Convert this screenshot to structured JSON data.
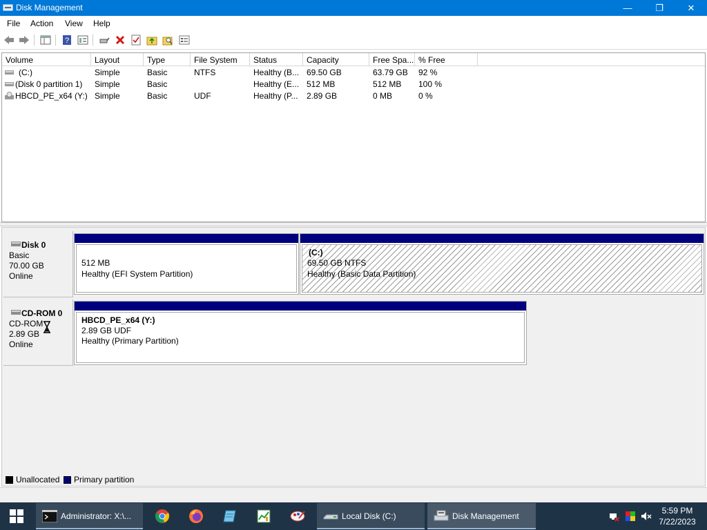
{
  "window": {
    "title": "Disk Management",
    "min_glyph": "—",
    "max_glyph": "❐",
    "close_glyph": "✕"
  },
  "menu": [
    "File",
    "Action",
    "View",
    "Help"
  ],
  "toolbar_icons": [
    "back-arrow-icon",
    "forward-arrow-icon",
    "console-tree-icon",
    "help-icon",
    "properties-icon",
    "connect-disk-icon",
    "delete-icon",
    "check-icon",
    "rescan-folder-icon",
    "search-folder-icon",
    "list-settings-icon"
  ],
  "volume_table": {
    "headers": [
      "Volume",
      "Layout",
      "Type",
      "File System",
      "Status",
      "Capacity",
      "Free Spa...",
      "% Free"
    ],
    "rows": [
      [
        "(C:)",
        "Simple",
        "Basic",
        "NTFS",
        "Healthy (B...",
        "69.50 GB",
        "63.79 GB",
        "92 %"
      ],
      [
        "(Disk 0 partition 1)",
        "Simple",
        "Basic",
        "",
        "Healthy (E...",
        "512 MB",
        "512 MB",
        "100 %"
      ],
      [
        "HBCD_PE_x64 (Y:)",
        "Simple",
        "Basic",
        "UDF",
        "Healthy (P...",
        "2.89 GB",
        "0 MB",
        "0 %"
      ]
    ]
  },
  "disks": [
    {
      "name": "Disk 0",
      "type": "Basic",
      "size": "70.00 GB",
      "status": "Online",
      "partitions": [
        {
          "title": "",
          "line1": "512 MB",
          "line2": "Healthy (EFI System Partition)"
        },
        {
          "title": "(C:)",
          "line1": "69.50 GB NTFS",
          "line2": "Healthy (Basic Data Partition)"
        }
      ]
    },
    {
      "name": "CD-ROM 0",
      "type": "CD-ROM",
      "size": "2.89 GB",
      "status": "Online",
      "partitions": [
        {
          "title": "HBCD_PE_x64  (Y:)",
          "line1": "2.89 GB UDF",
          "line2": "Healthy (Primary Partition)"
        }
      ]
    }
  ],
  "legend": [
    {
      "label": "Unallocated",
      "color": "#000000"
    },
    {
      "label": "Primary partition",
      "color": "#00007f"
    }
  ],
  "taskbar": {
    "tasks": [
      {
        "label": "Administrator: X:\\...",
        "icon": "cmd-icon"
      },
      {
        "label": "Local Disk (C:)",
        "icon": "drive-icon"
      },
      {
        "label": "Disk Management",
        "icon": "disk-management-icon"
      }
    ],
    "pinned": [
      "chrome-icon",
      "firefox-icon",
      "notepad-icon",
      "chart-app-icon",
      "paint-icon"
    ],
    "clock": {
      "time": "5:59 PM",
      "date": "7/22/2023"
    }
  },
  "colors": {
    "titlebar": "#0078d7",
    "partition_bar": "#00007f",
    "taskbar": "#1f3347"
  }
}
